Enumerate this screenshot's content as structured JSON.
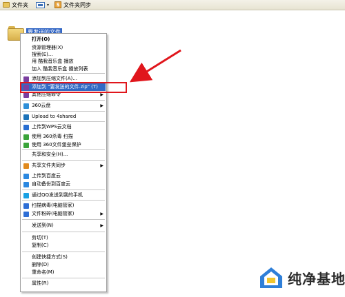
{
  "toolbar": {
    "folders_label": "文件夹",
    "views_caret": "▾",
    "sync_label": "文件夹同步"
  },
  "folder": {
    "name": "要发送的文件"
  },
  "context_menu": {
    "selected_index": 6,
    "items": [
      {
        "label": "打开(O)",
        "bold": true,
        "icon": "none"
      },
      {
        "label": "资源管理器(X)",
        "icon": "none"
      },
      {
        "label": "搜索(E)...",
        "icon": "none"
      },
      {
        "label": "用 酷我音乐盒 播放",
        "icon": "none"
      },
      {
        "label": "加入 酷我音乐盒 播放列表",
        "icon": "none"
      },
      {
        "label": "添加到压缩文件(A)...",
        "icon": "winrar-icon"
      },
      {
        "label": "添加到 \"要发送的文件.zip\" (T)",
        "icon": "winrar-icon"
      },
      {
        "label": "其他压缩命令",
        "icon": "winrar-icon",
        "submenu": true
      },
      {
        "label": "360云盘",
        "icon": "cloud-360-icon",
        "submenu": true
      },
      {
        "label": "Upload to 4shared",
        "icon": "fourshared-icon"
      },
      {
        "label": "上传到WPS云文档",
        "icon": "wps-icon"
      },
      {
        "label": "使用 360杀毒 扫描",
        "icon": "shield-360-icon"
      },
      {
        "label": "使用 360文件堡垒保护",
        "icon": "shield-360-icon"
      },
      {
        "label": "共享和安全(H)...",
        "icon": "none"
      },
      {
        "label": "共享文件夹同步",
        "icon": "sync-icon",
        "submenu": true
      },
      {
        "label": "上传到百度云",
        "icon": "baidu-cloud-icon"
      },
      {
        "label": "自动备份到百度云",
        "icon": "baidu-cloud-icon"
      },
      {
        "label": "通过QQ发送到我的手机",
        "icon": "qq-icon"
      },
      {
        "label": "扫描病毒(电脑管家)",
        "icon": "guard-icon"
      },
      {
        "label": "文件粉碎(电脑管家)",
        "icon": "guard-icon",
        "submenu": true
      },
      {
        "label": "发送到(N)",
        "icon": "none",
        "submenu": true
      },
      {
        "label": "剪切(T)",
        "icon": "none"
      },
      {
        "label": "复制(C)",
        "icon": "none"
      },
      {
        "label": "创建快捷方式(S)",
        "icon": "none"
      },
      {
        "label": "删除(D)",
        "icon": "none"
      },
      {
        "label": "重命名(M)",
        "icon": "none"
      },
      {
        "label": "属性(R)",
        "icon": "none"
      }
    ]
  },
  "icon_colors": {
    "winrar-icon": "#7b3fa0",
    "cloud-360-icon": "#2f8fd8",
    "fourshared-icon": "#1d73b9",
    "wps-icon": "#2a6fd1",
    "shield-360-icon": "#3aa43a",
    "sync-icon": "#e08a1f",
    "baidu-cloud-icon": "#2b88e0",
    "qq-icon": "#1aa1e3",
    "guard-icon": "#2f6fd6"
  },
  "colors": {
    "highlight": "#316ac5",
    "annotation_red": "#e0161c",
    "selection": "#3165c4"
  },
  "watermark": {
    "text": "纯净基地"
  }
}
